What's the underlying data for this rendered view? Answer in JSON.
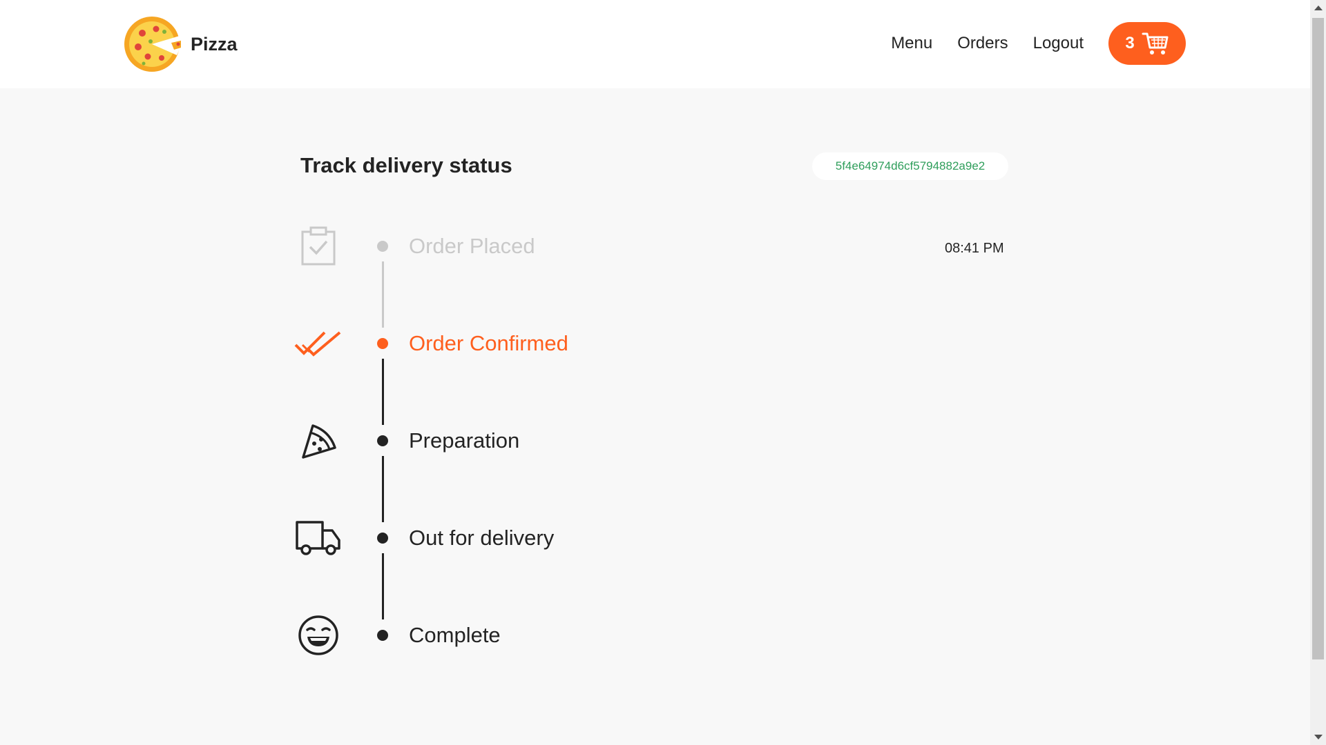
{
  "header": {
    "brand": "Pizza",
    "nav": [
      {
        "label": "Menu"
      },
      {
        "label": "Orders"
      },
      {
        "label": "Logout"
      }
    ],
    "cart_count": "3"
  },
  "main": {
    "title": "Track delivery status",
    "order_id": "5f4e64974d6cf5794882a9e2",
    "steps": [
      {
        "label": "Order Placed",
        "time": "08:41 PM",
        "state": "done",
        "icon": "clipboard-check-icon"
      },
      {
        "label": "Order Confirmed",
        "state": "current",
        "icon": "double-check-icon"
      },
      {
        "label": "Preparation",
        "state": "pending",
        "icon": "pizza-slice-icon"
      },
      {
        "label": "Out for delivery",
        "state": "pending",
        "icon": "delivery-truck-icon"
      },
      {
        "label": "Complete",
        "state": "pending",
        "icon": "smiley-face-icon"
      }
    ]
  },
  "colors": {
    "accent": "#fe5f1e",
    "done": "#c9c9c9",
    "pending": "#232323",
    "order_id_text": "#2f9e5b"
  }
}
